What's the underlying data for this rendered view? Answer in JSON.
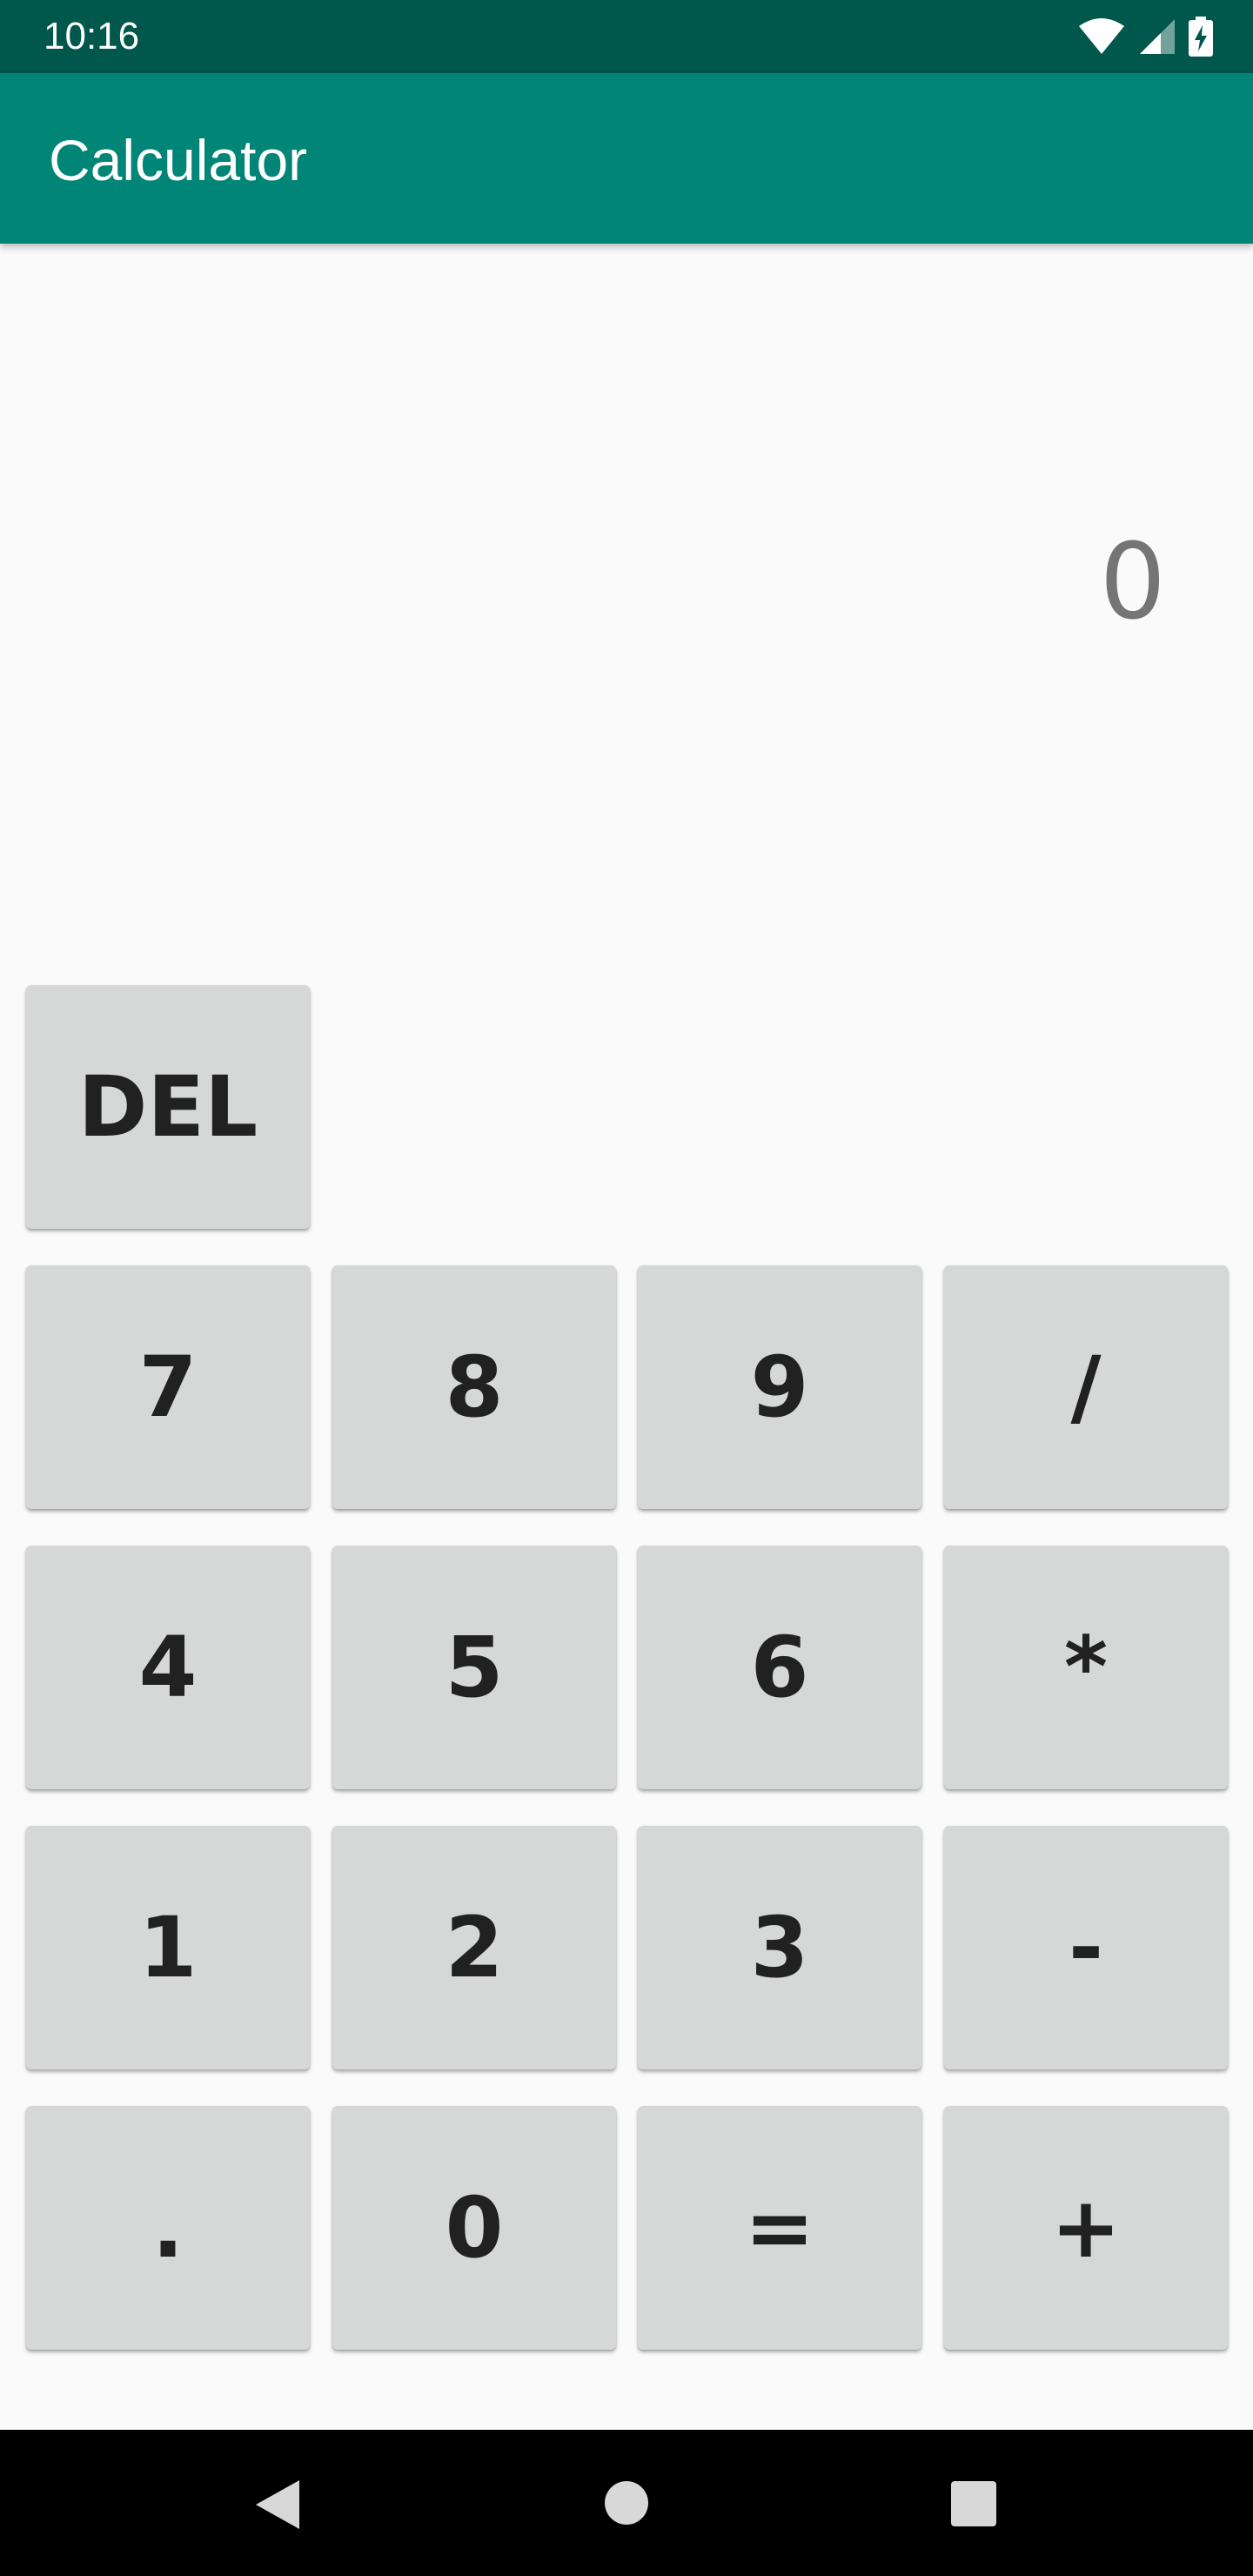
{
  "status_bar": {
    "time": "10:16",
    "icons": [
      "wifi-icon",
      "cellular-signal-icon",
      "battery-charging-icon"
    ]
  },
  "app_bar": {
    "title": "Calculator",
    "color": "#008577",
    "status_color": "#00574b"
  },
  "display": {
    "value": "0"
  },
  "keypad": {
    "del": "DEL",
    "rows": [
      [
        "7",
        "8",
        "9",
        "/"
      ],
      [
        "4",
        "5",
        "6",
        "*"
      ],
      [
        "1",
        "2",
        "3",
        "-"
      ],
      [
        ".",
        "0",
        "=",
        "+"
      ]
    ]
  },
  "nav_bar": {
    "icons": [
      "back-icon",
      "home-icon",
      "recents-icon"
    ]
  }
}
